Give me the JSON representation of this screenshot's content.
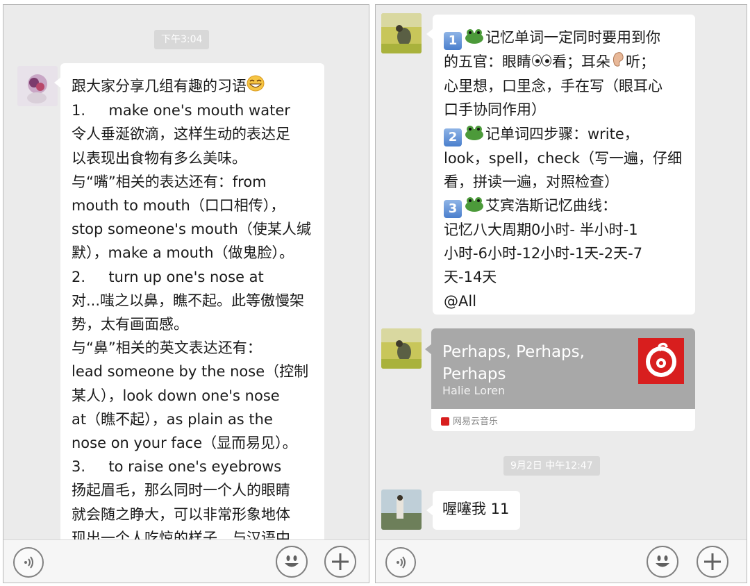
{
  "left": {
    "timestamp": "下午3:04",
    "message_lines": [
      "跟大家分享几组有趣的习语",
      "1.     make one's mouth water",
      "令人垂涎欲滴，这样生动的表达足",
      "以表现出食物有多么美味。",
      "与“嘴”相关的表达还有：from",
      "mouth to mouth（口口相传），",
      "stop someone's mouth（使某人缄",
      "默），make a mouth（做鬼脸）。",
      "2.     turn up one's nose at",
      "对...嗤之以鼻，瞧不起。此等傲慢架",
      "势，太有画面感。",
      "与“鼻”相关的英文表达还有：",
      "lead someone by the nose（控制",
      "某人），look down one's nose",
      "at（瞧不起），as plain as the",
      "nose on your face（显而易见）。",
      "3.     to raise one's eyebrows",
      "扬起眉毛，那么同时一个人的眼睛",
      "就会随之睁大，可以非常形象地体",
      "现出一个人吃惊的样子，与汉语中"
    ]
  },
  "right": {
    "tip1_lines": [
      "记忆单词一定同时要用到你",
      "的五官：眼睛",
      "看；耳朵",
      "听；"
    ],
    "tip1_rest": [
      "心里想，口里念，手在写（眼耳心",
      "口手协同作用）"
    ],
    "tip2_lines": [
      "记单词四步骤：write，",
      "look，spell，check（写一遍，仔细",
      "看，拼读一遍，对照检查）"
    ],
    "tip3_lines": [
      "艾宾浩斯记忆曲线：",
      "记忆八大周期0小时- 半小时-1",
      "小时-6小时-12小时-1天-2天-7",
      "天-14天",
      "@All"
    ],
    "numbers": [
      "1",
      "2",
      "3"
    ],
    "music": {
      "title": "Perhaps, Perhaps, Perhaps",
      "artist": "Halie Loren",
      "source": "网易云音乐"
    },
    "timestamp": "9月2日 中午12:47",
    "last_message": "喔噻我 11"
  },
  "icons": {
    "voice": "voice-icon",
    "emoji": "emoji-icon",
    "plus": "plus-icon"
  },
  "colors": {
    "background": "#ebebeb",
    "bubble": "#ffffff",
    "music_card": "#a8a8a8",
    "netease_red": "#d81e1e"
  }
}
